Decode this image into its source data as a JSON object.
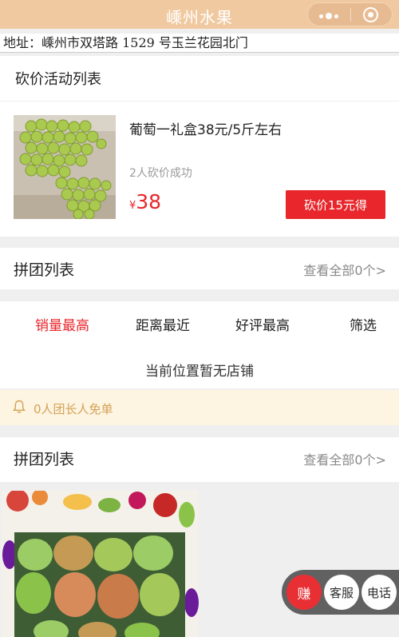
{
  "header": {
    "title": "嵊州水果"
  },
  "address": "地址：嵊州市双塔路 1529 号玉兰花园北门",
  "bargain": {
    "section_title": "砍价活动列表",
    "product_name": "葡萄一礼盒38元/5斤左右",
    "success_text": "2人砍价成功",
    "currency": "¥",
    "price": "38",
    "button_label": "砍价15元得"
  },
  "group_list_1": {
    "title": "拼团列表",
    "view_all": "查看全部0个>"
  },
  "tabs": {
    "items": [
      "销量最高",
      "距离最近",
      "好评最高",
      "筛选"
    ],
    "active": "销量最高",
    "empty_text": "当前位置暂无店铺"
  },
  "notice": {
    "text": "0人团长人免单"
  },
  "group_list_2": {
    "title": "拼团列表",
    "view_all": "查看全部0个>"
  },
  "float_buttons": {
    "earn": "赚",
    "service": "客服",
    "phone": "电话"
  },
  "colors": {
    "accent": "#e8262b",
    "header": "#f0c9a0",
    "notice_bg": "#fdf4e1",
    "notice_text": "#d4a257"
  }
}
